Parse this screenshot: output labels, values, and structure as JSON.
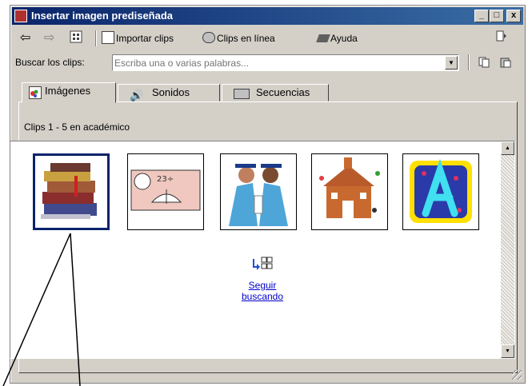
{
  "window": {
    "title": "Insertar imagen prediseñada",
    "controls": {
      "minimize": "_",
      "maximize": "□",
      "close": "x"
    }
  },
  "toolbar": {
    "import_label": "Importar clips",
    "online_label": "Clips en línea",
    "help_label": "Ayuda"
  },
  "search": {
    "label": "Buscar los clips:",
    "placeholder": "Escriba una o varias palabras..."
  },
  "tabs": [
    {
      "label": "Imágenes",
      "active": true
    },
    {
      "label": "Sonidos",
      "active": false
    },
    {
      "label": "Secuencias",
      "active": false
    }
  ],
  "results": {
    "header": "Clips 1 - 5 en académico",
    "thumbnails": [
      {
        "name": "libros"
      },
      {
        "name": "estudio"
      },
      {
        "name": "graduados"
      },
      {
        "name": "escuela"
      },
      {
        "name": "letra-a"
      }
    ],
    "more_line1": "Seguir",
    "more_line2": "buscando"
  },
  "colors": {
    "titlebar": "#0a246a",
    "link": "#0000cc",
    "selection": "#0a246a"
  }
}
